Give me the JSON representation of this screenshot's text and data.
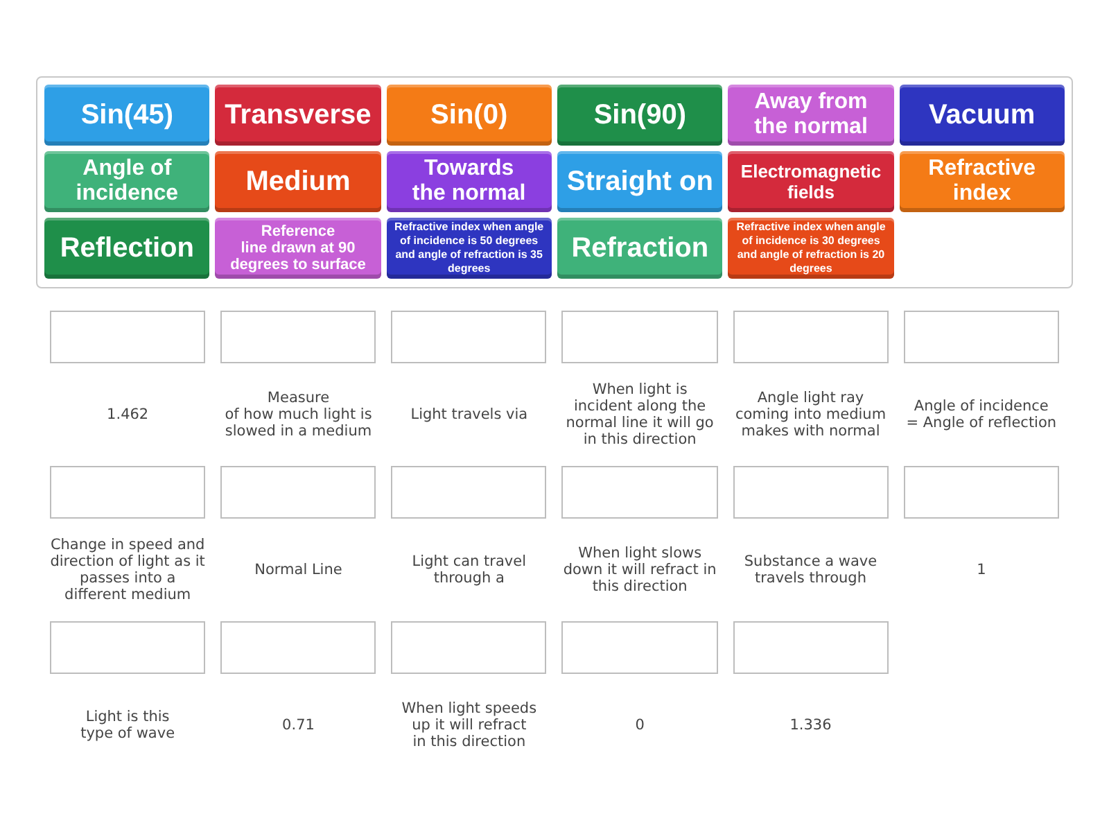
{
  "tiles": [
    {
      "text": "Sin(45)",
      "color": "#2e9fe6",
      "kind": "big"
    },
    {
      "text": "Transverse",
      "color": "#d42a3c",
      "kind": "big"
    },
    {
      "text": "Sin(0)",
      "color": "#f47b16",
      "kind": "big"
    },
    {
      "text": "Sin(90)",
      "color": "#1f8f4a",
      "kind": "big"
    },
    {
      "text": "Away from\nthe normal",
      "color": "#c760d6",
      "kind": "medium"
    },
    {
      "text": "Vacuum",
      "color": "#2e35c0",
      "kind": "big"
    },
    {
      "text": "Angle of\nincidence",
      "color": "#3fb27a",
      "kind": "medium"
    },
    {
      "text": "Medium",
      "color": "#e64a19",
      "kind": "big"
    },
    {
      "text": "Towards\nthe normal",
      "color": "#8b3fe0",
      "kind": "medium"
    },
    {
      "text": "Straight on",
      "color": "#2e9fe6",
      "kind": "big"
    },
    {
      "text": "Electromagnetic\nfields",
      "color": "#d42a3c",
      "kind": "small"
    },
    {
      "text": "Refractive\nindex",
      "color": "#f47b16",
      "kind": "medium"
    },
    {
      "text": "Reflection",
      "color": "#1f8f4a",
      "kind": "big"
    },
    {
      "text": "Reference\nline drawn at 90\ndegrees to surface",
      "color": "#c760d6",
      "kind": "note"
    },
    {
      "text": "Refractive index when angle of incidence is 50 degrees and angle of refraction is 35 degrees",
      "color": "#2e35c0",
      "kind": "tiny"
    },
    {
      "text": "Refraction",
      "color": "#3fb27a",
      "kind": "big"
    },
    {
      "text": "Refractive index when angle of incidence is 30 degrees and angle of refraction is 20 degrees",
      "color": "#e64a19",
      "kind": "tiny"
    }
  ],
  "targets": [
    {
      "label": "1.462"
    },
    {
      "label": "Measure\nof how much light is\nslowed in a medium"
    },
    {
      "label": "Light travels via"
    },
    {
      "label": "When light is incident along the normal line it will go in this direction"
    },
    {
      "label": "Angle light ray coming into medium makes with normal"
    },
    {
      "label": "Angle of incidence\n= Angle of reflection"
    },
    {
      "label": "Change in speed and direction of light as it passes into a different medium"
    },
    {
      "label": "Normal Line"
    },
    {
      "label": "Light can travel through a"
    },
    {
      "label": "When light slows down it will refract in this direction"
    },
    {
      "label": "Substance a wave travels through"
    },
    {
      "label": "1"
    },
    {
      "label": "Light is this\ntype of wave"
    },
    {
      "label": "0.71"
    },
    {
      "label": "When light speeds\nup it will refract\nin this direction"
    },
    {
      "label": "0"
    },
    {
      "label": "1.336"
    }
  ]
}
